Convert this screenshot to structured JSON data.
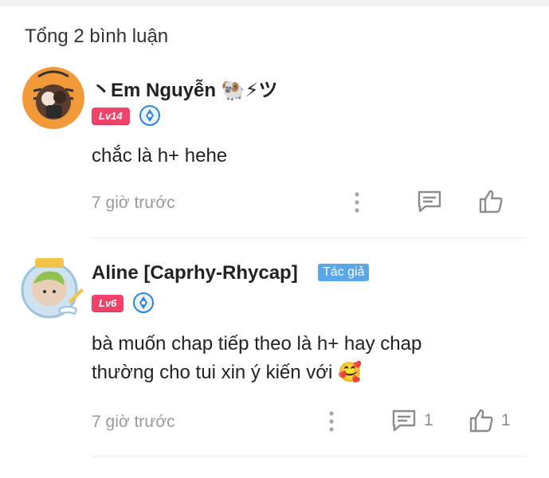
{
  "header": {
    "title": "Tổng 2 bình luận"
  },
  "comments": [
    {
      "name": "丶Em Nguyễn 🐏⚡ツ",
      "level": "Lv14",
      "content": "chắc là h+ hehe",
      "time": "7 giờ trước",
      "reply_count": "",
      "like_count": ""
    },
    {
      "name": "Aline [Caprhy-Rhycap]",
      "author_tag": "Tác giả",
      "level": "Lv6",
      "content": "bà muốn chap tiếp theo là h+ hay chap\nthường cho tui xin ý kiến với 🥰",
      "time": "7 giờ trước",
      "reply_count": "1",
      "like_count": "1"
    }
  ],
  "colors": {
    "level_badge": "#f0436a",
    "author_tag": "#5aa7e8",
    "meta_text": "#9a9a9a"
  }
}
